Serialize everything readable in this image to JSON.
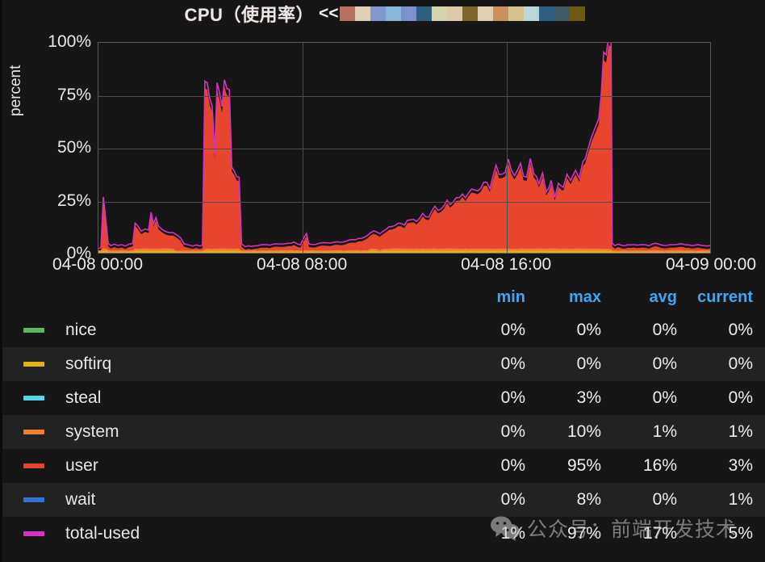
{
  "panel": {
    "title": "CPU（使用率）",
    "collapse_label": "<<",
    "palette": [
      "#b5705f",
      "#ded0b6",
      "#8496ce",
      "#89b8d6",
      "#7f91cd",
      "#2f5f7c",
      "#d4d3ae",
      "#dcc9ac",
      "#7c6527",
      "#e0cfb2",
      "#c7925e",
      "#d5c18b",
      "#bcd5d8",
      "#2d5f80",
      "#425a63",
      "#6d5a16"
    ]
  },
  "chart_data": {
    "type": "area",
    "title": "CPU（使用率）",
    "xlabel": "",
    "ylabel": "percent",
    "ylim": [
      0,
      100
    ],
    "yticks": [
      "0%",
      "25%",
      "50%",
      "75%",
      "100%"
    ],
    "ytick_values": [
      0,
      25,
      50,
      75,
      100
    ],
    "xticks": [
      "04-08 00:00",
      "04-08 08:00",
      "04-08 16:00",
      "04-09 00:00"
    ],
    "xtick_positions": [
      0,
      33.3,
      66.6,
      100
    ],
    "grid": true,
    "legend_position": "below-table",
    "series": [
      {
        "name": "nice",
        "color": "#60b660",
        "min": "0%",
        "max": "0%",
        "avg": "0%",
        "current": "0%"
      },
      {
        "name": "softirq",
        "color": "#e3b018",
        "min": "0%",
        "max": "0%",
        "avg": "0%",
        "current": "0%"
      },
      {
        "name": "steal",
        "color": "#55d6e3",
        "min": "0%",
        "max": "3%",
        "avg": "0%",
        "current": "0%"
      },
      {
        "name": "system",
        "color": "#ef8033",
        "min": "0%",
        "max": "10%",
        "avg": "1%",
        "current": "1%"
      },
      {
        "name": "user",
        "color": "#e8452e",
        "min": "0%",
        "max": "95%",
        "avg": "16%",
        "current": "3%"
      },
      {
        "name": "wait",
        "color": "#3573d6",
        "min": "0%",
        "max": "8%",
        "avg": "0%",
        "current": "1%"
      },
      {
        "name": "total-used",
        "color": "#d633c0",
        "min": "1%",
        "max": "97%",
        "avg": "17%",
        "current": "5%"
      }
    ],
    "user_points": [
      [
        0.0,
        0.5
      ],
      [
        0.4,
        1.0
      ],
      [
        0.8,
        24.0
      ],
      [
        1.2,
        14.0
      ],
      [
        1.6,
        3.0
      ],
      [
        2.0,
        2.0
      ],
      [
        2.6,
        2.5
      ],
      [
        3.2,
        2.0
      ],
      [
        3.8,
        2.5
      ],
      [
        4.4,
        2.0
      ],
      [
        5.0,
        2.5
      ],
      [
        5.6,
        3.0
      ],
      [
        6.0,
        13.0
      ],
      [
        6.4,
        12.0
      ],
      [
        7.0,
        9.0
      ],
      [
        7.6,
        10.0
      ],
      [
        8.2,
        9.0
      ],
      [
        8.6,
        18.0
      ],
      [
        9.0,
        12.0
      ],
      [
        9.4,
        16.0
      ],
      [
        9.8,
        11.0
      ],
      [
        10.4,
        10.0
      ],
      [
        11.0,
        9.0
      ],
      [
        11.6,
        8.5
      ],
      [
        12.2,
        8.0
      ],
      [
        12.8,
        7.0
      ],
      [
        13.4,
        6.0
      ],
      [
        14.0,
        3.0
      ],
      [
        14.6,
        2.5
      ],
      [
        15.0,
        2.0
      ],
      [
        15.4,
        2.0
      ],
      [
        16.0,
        2.5
      ],
      [
        16.6,
        2.0
      ],
      [
        17.0,
        2.0
      ],
      [
        17.4,
        76.0
      ],
      [
        17.8,
        79.0
      ],
      [
        18.2,
        72.0
      ],
      [
        18.6,
        70.0
      ],
      [
        19.0,
        45.0
      ],
      [
        19.4,
        74.0
      ],
      [
        19.8,
        71.0
      ],
      [
        20.2,
        68.0
      ],
      [
        20.6,
        77.0
      ],
      [
        21.0,
        78.0
      ],
      [
        21.4,
        74.0
      ],
      [
        21.8,
        40.0
      ],
      [
        22.2,
        36.0
      ],
      [
        22.6,
        34.0
      ],
      [
        23.0,
        33.0
      ],
      [
        23.4,
        3.0
      ],
      [
        24.0,
        1.5
      ],
      [
        25.0,
        1.8
      ],
      [
        26.0,
        2.0
      ],
      [
        27.0,
        2.5
      ],
      [
        28.0,
        2.0
      ],
      [
        29.0,
        3.0
      ],
      [
        30.0,
        2.5
      ],
      [
        31.0,
        3.0
      ],
      [
        32.0,
        3.5
      ],
      [
        33.0,
        2.5
      ],
      [
        34.0,
        8.0
      ],
      [
        34.4,
        3.0
      ],
      [
        35.0,
        2.5
      ],
      [
        36.0,
        3.0
      ],
      [
        37.0,
        3.5
      ],
      [
        38.0,
        3.0
      ],
      [
        39.0,
        4.0
      ],
      [
        40.0,
        3.5
      ],
      [
        41.0,
        4.5
      ],
      [
        42.0,
        5.0
      ],
      [
        43.0,
        5.5
      ],
      [
        44.0,
        7.0
      ],
      [
        45.0,
        9.0
      ],
      [
        46.0,
        8.0
      ],
      [
        47.0,
        10.0
      ],
      [
        48.0,
        11.0
      ],
      [
        49.0,
        13.0
      ],
      [
        50.0,
        12.0
      ],
      [
        51.0,
        15.0
      ],
      [
        52.0,
        14.0
      ],
      [
        53.0,
        17.0
      ],
      [
        54.0,
        16.0
      ],
      [
        55.0,
        20.0
      ],
      [
        56.0,
        19.0
      ],
      [
        57.0,
        23.0
      ],
      [
        58.0,
        22.0
      ],
      [
        59.0,
        26.0
      ],
      [
        60.0,
        25.0
      ],
      [
        61.0,
        29.0
      ],
      [
        62.0,
        27.0
      ],
      [
        63.0,
        33.0
      ],
      [
        64.0,
        30.0
      ],
      [
        65.0,
        38.0
      ],
      [
        66.0,
        34.0
      ],
      [
        67.0,
        42.0
      ],
      [
        68.0,
        36.0
      ],
      [
        69.0,
        39.0
      ],
      [
        70.0,
        33.0
      ],
      [
        70.6,
        44.0
      ],
      [
        71.2,
        36.0
      ],
      [
        72.0,
        30.0
      ],
      [
        72.6,
        35.0
      ],
      [
        73.2,
        28.0
      ],
      [
        74.0,
        33.0
      ],
      [
        74.6,
        26.0
      ],
      [
        75.2,
        31.0
      ],
      [
        76.0,
        29.0
      ],
      [
        76.6,
        35.0
      ],
      [
        77.2,
        32.0
      ],
      [
        78.0,
        38.0
      ],
      [
        78.6,
        34.0
      ],
      [
        79.2,
        42.0
      ],
      [
        80.0,
        45.0
      ],
      [
        80.6,
        52.0
      ],
      [
        81.2,
        58.0
      ],
      [
        81.8,
        64.0
      ],
      [
        82.2,
        72.0
      ],
      [
        82.6,
        88.0
      ],
      [
        83.0,
        95.0
      ],
      [
        83.4,
        95.0
      ],
      [
        83.8,
        95.0
      ],
      [
        84.0,
        3.0
      ],
      [
        84.4,
        2.0
      ],
      [
        85.0,
        2.5
      ],
      [
        86.0,
        2.0
      ],
      [
        87.0,
        2.5
      ],
      [
        88.0,
        2.0
      ],
      [
        89.0,
        2.5
      ],
      [
        90.0,
        2.0
      ],
      [
        91.0,
        3.0
      ],
      [
        92.0,
        2.5
      ],
      [
        93.0,
        2.0
      ],
      [
        94.0,
        2.5
      ],
      [
        95.0,
        3.0
      ],
      [
        96.0,
        2.5
      ],
      [
        97.0,
        2.0
      ],
      [
        98.0,
        2.5
      ],
      [
        99.0,
        2.0
      ],
      [
        100.0,
        2.0
      ]
    ]
  },
  "legend": {
    "headers": [
      "min",
      "max",
      "avg",
      "current"
    ]
  },
  "watermark": {
    "text": "公众号：前端开发技术"
  }
}
